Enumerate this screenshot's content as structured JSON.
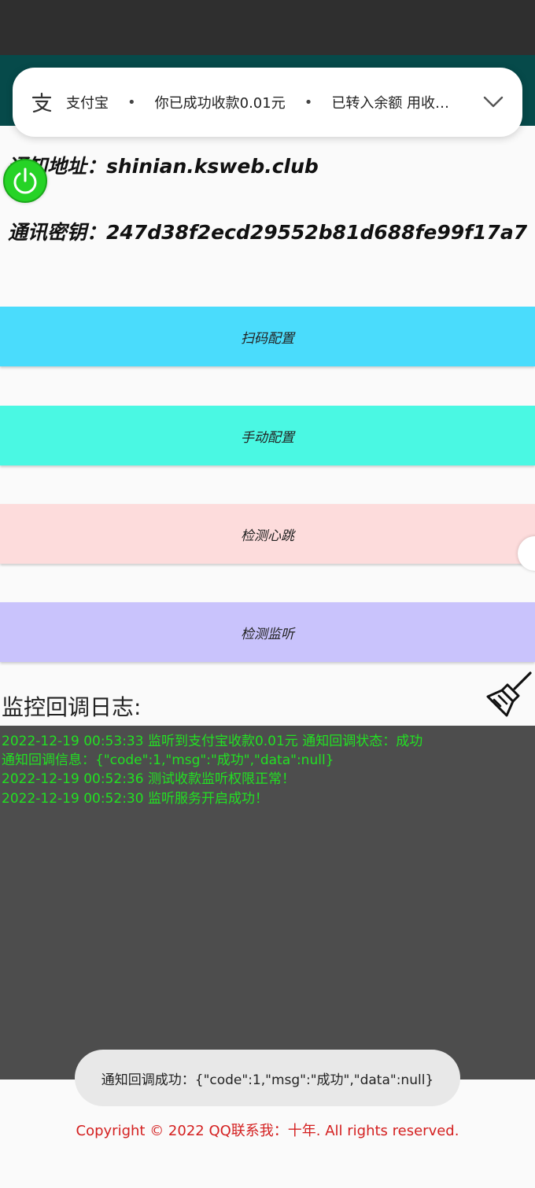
{
  "notification": {
    "app_name": "支付宝",
    "separator": "•",
    "title": "你已成功收款0.01元",
    "body": "已转入余额 用收…"
  },
  "info": {
    "url_line": "通知地址：shinian.ksweb.club",
    "key_line": "通讯密钥：247d38f2ecd29552b81d688fe99f17a7"
  },
  "buttons": {
    "scan": "扫码配置",
    "manual": "手动配置",
    "heartbeat": "检测心跳",
    "listen": "检测监听"
  },
  "log": {
    "title": "监控回调日志:",
    "lines": [
      "2022-12-19 00:53:33   监听到支付宝收款0.01元 通知回调状态：成功",
      "通知回调信息：{\"code\":1,\"msg\":\"成功\",\"data\":null}",
      "2022-12-19 00:52:36   测试收款监听权限正常！",
      "2022-12-19 00:52:30   监听服务开启成功！"
    ]
  },
  "toast": "通知回调成功：{\"code\":1,\"msg\":\"成功\",\"data\":null}",
  "copyright": "Copyright © 2022 QQ联系我：十年. All rights reserved.",
  "colors": {
    "scan_button": "#4adcfc",
    "manual_button": "#4af8e3",
    "heartbeat_button": "#fddcdc",
    "listen_button": "#c9c3fc",
    "log_text": "#22e022",
    "copyright": "#d42020"
  },
  "icons": {
    "app": "alipay-icon",
    "expand": "chevron-down-icon",
    "power": "power-icon",
    "clear_log": "broom-icon"
  }
}
